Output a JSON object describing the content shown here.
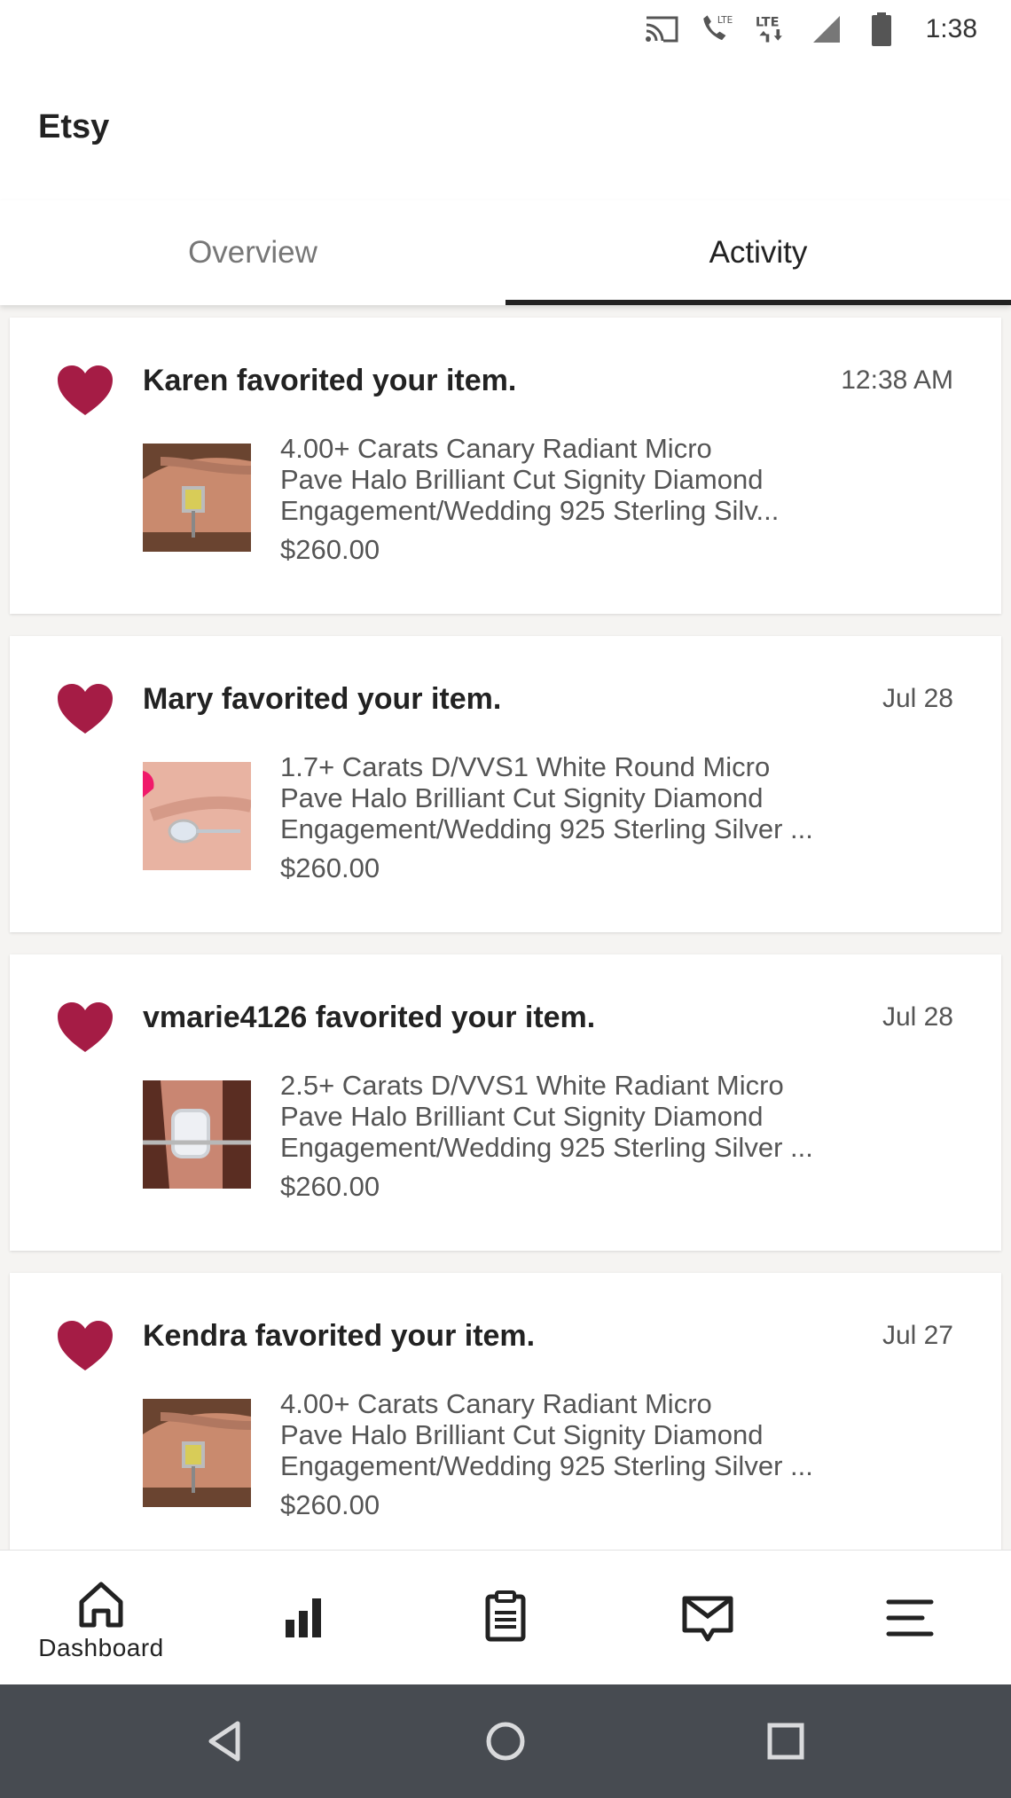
{
  "status_bar": {
    "time": "1:38",
    "icons": [
      "cast-icon",
      "lte-call-icon",
      "lte-data-icon",
      "signal-icon",
      "battery-icon"
    ],
    "lte_label": "LTE"
  },
  "app": {
    "title": "Etsy"
  },
  "tabs": [
    {
      "label": "Overview",
      "active": false
    },
    {
      "label": "Activity",
      "active": true
    }
  ],
  "colors": {
    "heart": "#a51c45",
    "text_primary": "#222222",
    "text_secondary": "#555555",
    "system_nav_bg": "#474b51"
  },
  "activity": [
    {
      "title": "Karen favorited your item.",
      "time": "12:38 AM",
      "desc_lines": [
        "4.00+ Carats Canary Radiant Micro",
        "Pave Halo Brilliant Cut Signity Diamond",
        "Engagement/Wedding 925 Sterling Silv..."
      ],
      "price": "$260.00",
      "thumb": "canary-ring-photo"
    },
    {
      "title": "Mary favorited your item.",
      "time": "Jul 28",
      "desc_lines": [
        "1.7+ Carats D/VVS1 White Round Micro",
        "Pave Halo Brilliant Cut Signity Diamond",
        "Engagement/Wedding 925 Sterling Silver ..."
      ],
      "price": "$260.00",
      "thumb": "round-ring-photo"
    },
    {
      "title": "vmarie4126 favorited your item.",
      "time": "Jul 28",
      "desc_lines": [
        "2.5+ Carats D/VVS1 White Radiant Micro",
        "Pave Halo Brilliant Cut Signity Diamond",
        "Engagement/Wedding 925 Sterling Silver ..."
      ],
      "price": "$260.00",
      "thumb": "radiant-ring-photo"
    },
    {
      "title": "Kendra favorited your item.",
      "time": "Jul 27",
      "desc_lines": [
        "4.00+ Carats Canary Radiant Micro",
        "Pave Halo Brilliant Cut Signity Diamond",
        "Engagement/Wedding 925 Sterling Silver ..."
      ],
      "price": "$260.00",
      "thumb": "canary-ring-photo"
    }
  ],
  "bottom_nav": [
    {
      "icon": "home-icon",
      "label": "Dashboard"
    },
    {
      "icon": "stats-icon",
      "label": ""
    },
    {
      "icon": "orders-clipboard-icon",
      "label": ""
    },
    {
      "icon": "messages-icon",
      "label": ""
    },
    {
      "icon": "menu-icon",
      "label": ""
    }
  ],
  "system_nav": [
    "back-icon",
    "home-circle-icon",
    "recents-icon"
  ]
}
